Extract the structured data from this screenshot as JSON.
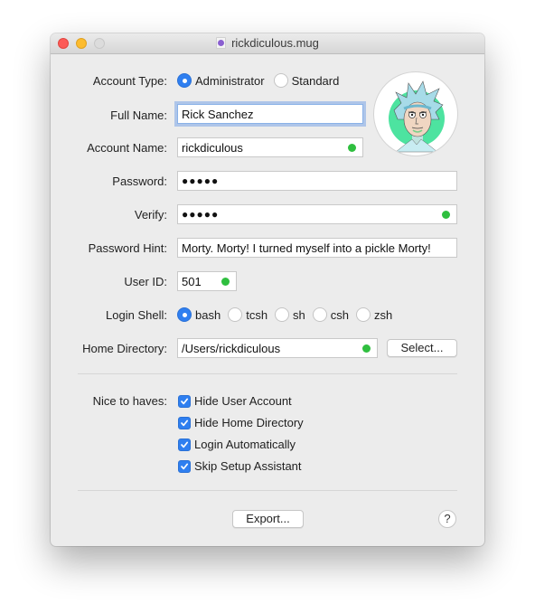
{
  "window": {
    "title": "rickdiculous.mug",
    "title_icon": "mug-document-icon"
  },
  "form": {
    "account_type": {
      "label": "Account Type:",
      "options": [
        {
          "label": "Administrator",
          "selected": true
        },
        {
          "label": "Standard",
          "selected": false
        }
      ]
    },
    "full_name": {
      "label": "Full Name:",
      "value": "Rick Sanchez"
    },
    "account_name": {
      "label": "Account Name:",
      "value": "rickdiculous",
      "valid": true
    },
    "password": {
      "label": "Password:",
      "value": "●●●●●"
    },
    "verify": {
      "label": "Verify:",
      "value": "●●●●●",
      "valid": true
    },
    "password_hint": {
      "label": "Password Hint:",
      "value": "Morty. Morty! I turned myself into a pickle Morty!"
    },
    "user_id": {
      "label": "User ID:",
      "value": "501",
      "valid": true
    },
    "login_shell": {
      "label": "Login Shell:",
      "options": [
        {
          "label": "bash",
          "selected": true
        },
        {
          "label": "tcsh",
          "selected": false
        },
        {
          "label": "sh",
          "selected": false
        },
        {
          "label": "csh",
          "selected": false
        },
        {
          "label": "zsh",
          "selected": false
        }
      ]
    },
    "home_directory": {
      "label": "Home Directory:",
      "value": "/Users/rickdiculous",
      "valid": true,
      "select_button": "Select..."
    },
    "nice_to_haves": {
      "label": "Nice to haves:",
      "items": [
        {
          "label": "Hide User Account",
          "checked": true
        },
        {
          "label": "Hide Home Directory",
          "checked": true
        },
        {
          "label": "Login Automatically",
          "checked": true
        },
        {
          "label": "Skip Setup Assistant",
          "checked": true
        }
      ]
    }
  },
  "avatar": {
    "description": "Rick Sanchez user picture"
  },
  "footer": {
    "export_button": "Export...",
    "help_button": "?"
  },
  "colors": {
    "accent": "#2f7ff0",
    "valid_dot": "#2fbf3f",
    "avatar_bg": "#4de3a0"
  }
}
